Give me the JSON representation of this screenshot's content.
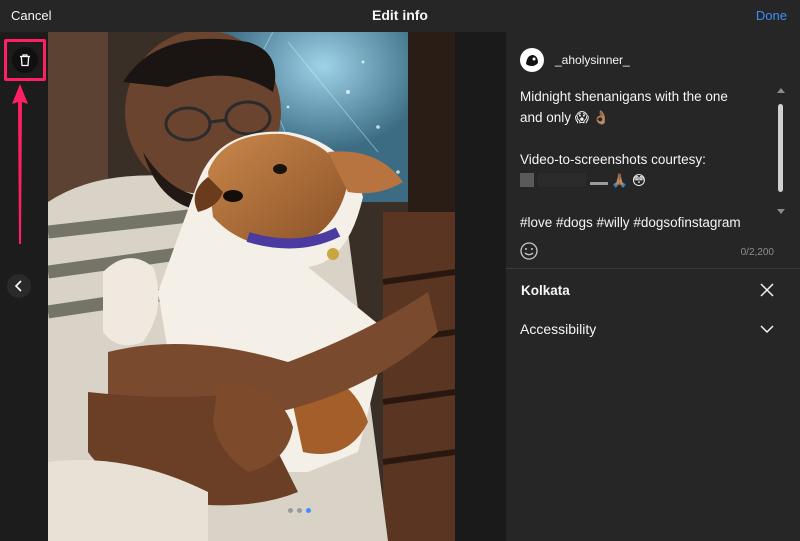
{
  "header": {
    "cancel_label": "Cancel",
    "title": "Edit info",
    "done_label": "Done"
  },
  "media": {
    "delete_icon": "trash-icon",
    "prev_icon": "chevron-left-icon",
    "carousel_count": 3,
    "carousel_active_index": 2,
    "annotation_color": "#ff2063"
  },
  "post": {
    "username": "_aholysinner_",
    "caption_line_1": "Midnight shenanigans with the one",
    "caption_line_2": "and only",
    "caption_line_2_emojis": "😱 👌🏽",
    "caption_line_3": "Video-to-screenshots courtesy:",
    "caption_line_4_emojis": "🙏🏽 😳",
    "caption_line_5": "#love #dogs #willy #dogsofinstagram",
    "char_counter": "0/2,200"
  },
  "settings": {
    "location": "Kolkata",
    "accessibility_label": "Accessibility"
  },
  "colors": {
    "accent": "#3f8efc",
    "panel_bg": "#262626",
    "highlight": "#ff2063"
  }
}
